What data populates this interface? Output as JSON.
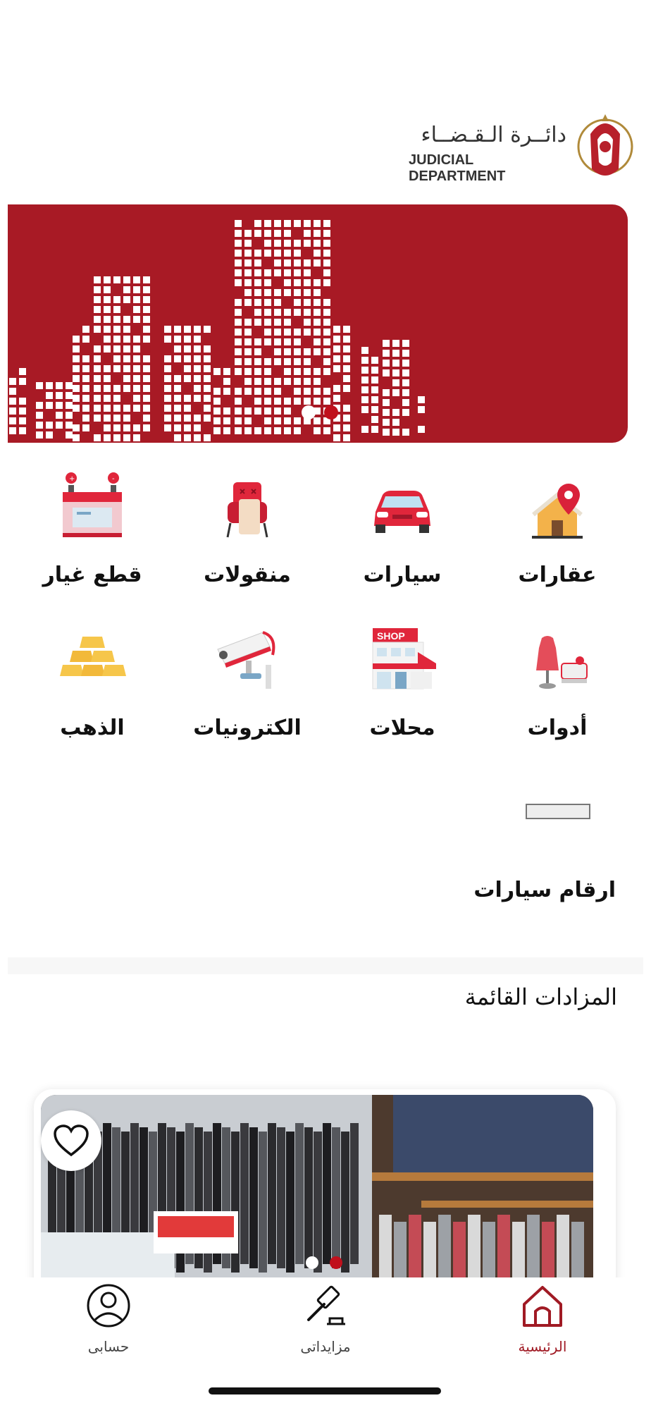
{
  "header": {
    "logo_ar": "دائــرة الـقـضــاء",
    "logo_en": "JUDICIAL DEPARTMENT"
  },
  "banner": {
    "slides": 2,
    "active_index": 1
  },
  "categories": [
    {
      "label": "عقارات",
      "icon": "house-location-icon"
    },
    {
      "label": "سيارات",
      "icon": "car-icon"
    },
    {
      "label": "منقولات",
      "icon": "furniture-icon"
    },
    {
      "label": "قطع غيار",
      "icon": "car-battery-icon"
    },
    {
      "label": "أدوات",
      "icon": "tools-dress-sewing-icon"
    },
    {
      "label": "محلات",
      "icon": "shop-icon"
    },
    {
      "label": "الكترونيات",
      "icon": "cctv-camera-icon"
    },
    {
      "label": "الذهب",
      "icon": "gold-bars-icon"
    },
    {
      "label": "ارقام سيارات",
      "icon": "license-plate-icon"
    }
  ],
  "auctions": {
    "title": "المزادات القائمة",
    "card": {
      "favorite_icon": "heart-icon",
      "image_slides": 2,
      "active_image": 1
    }
  },
  "bottom_nav": {
    "items": [
      {
        "label": "حسابى",
        "icon": "user-icon",
        "active": false
      },
      {
        "label": "مزايداتى",
        "icon": "gavel-icon",
        "active": false
      },
      {
        "label": "الرئيسية",
        "icon": "home-icon",
        "active": true
      }
    ]
  },
  "colors": {
    "brand_red": "#a81a25",
    "active_nav": "#a01a24",
    "text": "#111111"
  }
}
